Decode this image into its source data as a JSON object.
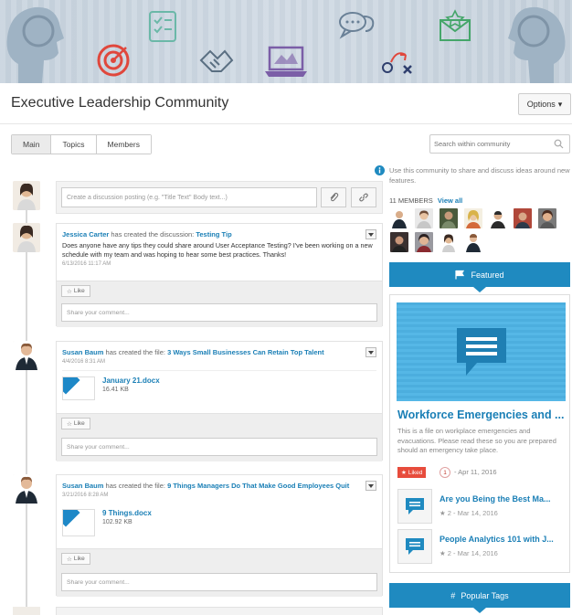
{
  "community": {
    "title": "Executive Leadership Community",
    "options_label": "Options"
  },
  "tabs": [
    {
      "label": "Main",
      "active": true
    },
    {
      "label": "Topics",
      "active": false
    },
    {
      "label": "Members",
      "active": false
    }
  ],
  "search": {
    "placeholder": "Search within community"
  },
  "composer": {
    "placeholder": "Create a discussion posting (e.g. \"Title Text\" Body text...)"
  },
  "posts": [
    {
      "author": "Jessica Carter",
      "action": " has created the discussion: ",
      "title": "Testing Tip",
      "body": "Does anyone have any tips they could share around User Acceptance Testing? I've been working on a new schedule with my team and was hoping to hear some best practices. Thanks!",
      "timestamp": "6/13/2016 11:17 AM",
      "like_label": "Like",
      "comment_placeholder": "Share your comment..."
    },
    {
      "author": "Susan Baum",
      "action": " has created the file: ",
      "title": "3 Ways Small Businesses Can Retain Top Talent",
      "timestamp": "4/4/2016 8:31 AM",
      "file_name": "January 21.docx",
      "file_size": "16.41 KB",
      "like_label": "Like",
      "comment_placeholder": "Share your comment..."
    },
    {
      "author": "Susan Baum",
      "action": " has created the file: ",
      "title": "9 Things Managers Do That Make Good Employees Quit",
      "timestamp": "3/21/2016 8:28 AM",
      "file_name": "9 Things.docx",
      "file_size": "102.92 KB",
      "like_label": "Like",
      "comment_placeholder": "Share your comment..."
    }
  ],
  "sidebar": {
    "info": "Use this community to share and discuss ideas around new features.",
    "members_count": "11 MEMBERS",
    "view_all": "View all",
    "featured_label": "Featured",
    "featured": {
      "title": "Workforce Emergencies and ...",
      "description": "This is a file on workplace emergencies and evacuations. Please read these so you are prepared should an emergency take place.",
      "liked_label": "Liked",
      "like_count": "1",
      "date": "- Apr 11, 2016"
    },
    "items": [
      {
        "title": "Are you Being the Best Ma...",
        "meta": "★ 2  - Mar 14, 2016"
      },
      {
        "title": "People Analytics 101 with J...",
        "meta": "★ 2  - Mar 14, 2016"
      }
    ],
    "popular_tags_label": "Popular Tags"
  },
  "colors": {
    "accent": "#1f8ac0",
    "link": "#1a7fb6",
    "liked": "#e74c3c",
    "banner_icon": "#7b5ea7"
  }
}
